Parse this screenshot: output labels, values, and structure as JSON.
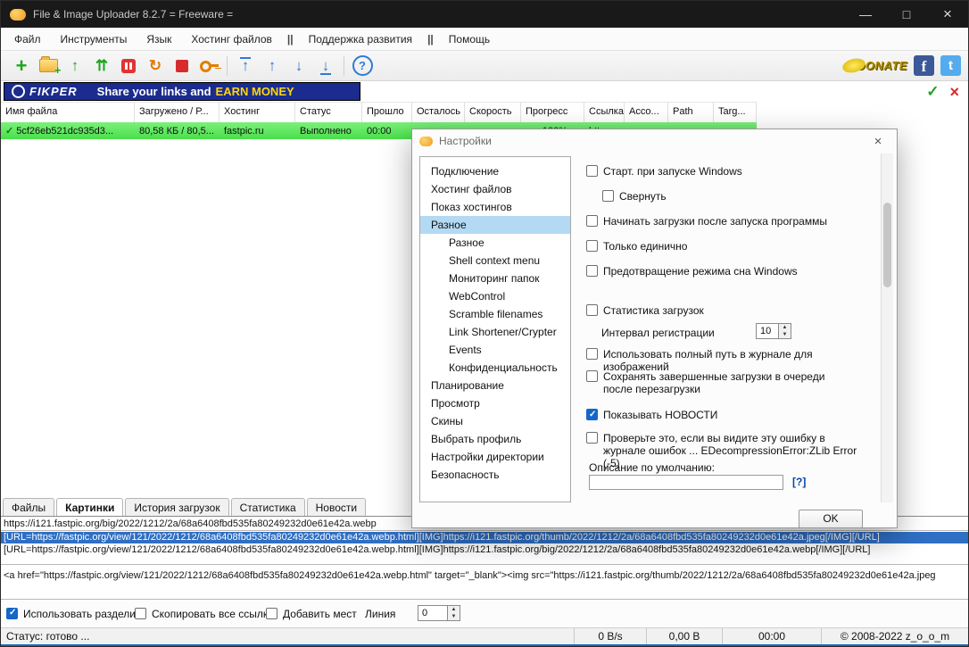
{
  "titlebar": {
    "title": "File & Image Uploader 8.2.7  = Freeware =",
    "minimize": "—",
    "maximize": "□",
    "close": "×"
  },
  "menu": {
    "items": [
      "Файл",
      "Инструменты",
      "Язык",
      "Хостинг файлов",
      "||",
      "Поддержка развития",
      "||",
      "Помощь"
    ]
  },
  "toolbar": {
    "icons": [
      {
        "name": "add",
        "glyph": "+"
      },
      {
        "name": "add-folder",
        "glyph": ""
      },
      {
        "name": "upload",
        "glyph": "↑"
      },
      {
        "name": "upload-all",
        "glyph": "⇈"
      },
      {
        "name": "pause",
        "glyph": ""
      },
      {
        "name": "restart",
        "glyph": "↻"
      },
      {
        "name": "stop",
        "glyph": ""
      },
      {
        "name": "key",
        "glyph": ""
      },
      {
        "name": "move-top",
        "glyph": "↑"
      },
      {
        "name": "move-up",
        "glyph": "↑"
      },
      {
        "name": "move-down",
        "glyph": "↓"
      },
      {
        "name": "move-bottom",
        "glyph": "↓"
      },
      {
        "name": "help",
        "glyph": "?"
      }
    ],
    "donate": "DONATE",
    "social": [
      {
        "name": "facebook-icon",
        "glyph": "f"
      },
      {
        "name": "twitter-icon",
        "glyph": "t"
      }
    ]
  },
  "banner": {
    "brand": "FIKPER",
    "text": "Share your links and",
    "highlight": "EARN MONEY",
    "apply_glyph": "✓",
    "close_glyph": "×"
  },
  "table": {
    "columns": [
      "Имя файла",
      "Загружено / Р...",
      "Хостинг",
      "Статус",
      "Прошло",
      "Осталось",
      "Скорость",
      "Прогресс",
      "Ссылка",
      "Acco...",
      "Path",
      "Targ..."
    ],
    "rows": [
      {
        "icon": "✓",
        "cells": [
          "5cf26eb521dc935d3...",
          "80,58 КБ / 80,5...",
          "fastpic.ru",
          "Выполнено",
          "00:00",
          "",
          "",
          "100%",
          "htt...",
          "",
          "",
          ""
        ]
      }
    ]
  },
  "dialog": {
    "title": "Настройки",
    "close": "×",
    "tree": [
      {
        "label": "Подключение",
        "selected": false
      },
      {
        "label": "Хостинг файлов",
        "selected": false
      },
      {
        "label": "Показ хостингов",
        "selected": false
      },
      {
        "label": "Разное",
        "selected": true
      },
      {
        "label": "Разное",
        "selected": false
      },
      {
        "label": "Shell context menu",
        "selected": false
      },
      {
        "label": "Мониторинг папок",
        "selected": false
      },
      {
        "label": "WebControl",
        "selected": false
      },
      {
        "label": "Scramble filenames",
        "selected": false
      },
      {
        "label": "Link Shortener/Crypter",
        "selected": false
      },
      {
        "label": "Events",
        "selected": false
      },
      {
        "label": "Конфиденциальность",
        "selected": false
      },
      {
        "label": "Планирование",
        "selected": false
      },
      {
        "label": "Просмотр",
        "selected": false
      },
      {
        "label": "Скины",
        "selected": false
      },
      {
        "label": "Выбрать профиль",
        "selected": false
      },
      {
        "label": "Настройки директории",
        "selected": false
      },
      {
        "label": "Безопасность",
        "selected": false
      }
    ],
    "checkboxes": [
      {
        "label": "Старт. при запуске Windows",
        "checked": false
      },
      {
        "label": "Свернуть",
        "checked": false
      },
      {
        "label": "Начинать загрузки после запуска программы",
        "checked": false
      },
      {
        "label": "Только единично",
        "checked": false
      },
      {
        "label": "Предотвращение режима сна Windows",
        "checked": false
      },
      {
        "label": "Статистика загрузок",
        "checked": false
      },
      {
        "label": "Использовать полный путь в журнале для изображений",
        "checked": false
      },
      {
        "label": "Сохранять завершенные загрузки в очереди после перезагрузки",
        "checked": false
      },
      {
        "label": "Показывать НОВОСТИ",
        "checked": true
      },
      {
        "label": "Проверьте это, если вы видите эту ошибку в журнале ошибок ...  EDecompressionError:ZLib Error (-5)",
        "checked": false
      }
    ],
    "interval_label": "Интервал регистрации",
    "interval_value": "10",
    "description_label": "Описание по умолчанию:",
    "description_value": "",
    "help_link": "[?]",
    "ok": "OK"
  },
  "tabs": {
    "items": [
      {
        "label": "Файлы",
        "active": false
      },
      {
        "label": "Картинки",
        "active": true
      },
      {
        "label": "История загрузок",
        "active": false
      },
      {
        "label": "Статистика",
        "active": false
      },
      {
        "label": "Новости",
        "active": false
      }
    ]
  },
  "links": {
    "lines": [
      {
        "text": "https://i121.fastpic.org/big/2022/1212/2a/68a6408fbd535fa80249232d0e61e42a.webp",
        "selected": false
      },
      {
        "text": "[URL=https://fastpic.org/view/121/2022/1212/68a6408fbd535fa80249232d0e61e42a.webp.html][IMG]https://i121.fastpic.org/thumb/2022/1212/2a/68a6408fbd535fa80249232d0e61e42a.jpeg[/IMG][/URL]",
        "selected": true
      },
      {
        "text": "[URL=https://fastpic.org/view/121/2022/1212/68a6408fbd535fa80249232d0e61e42a.webp.html][IMG]https://i121.fastpic.org/big/2022/1212/2a/68a6408fbd535fa80249232d0e61e42a.webp[/IMG][/URL]",
        "selected": false
      },
      {
        "text": "<a href=\"https://fastpic.org/view/121/2022/1212/68a6408fbd535fa80249232d0e61e42a.webp.html\" target=\"_blank\"><img src=\"https://i121.fastpic.org/thumb/2022/1212/2a/68a6408fbd535fa80249232d0e61e42a.jpeg",
        "selected": false
      }
    ]
  },
  "footer": {
    "checkboxes": [
      {
        "label": "Использовать раздели",
        "checked": true
      },
      {
        "label": "Скопировать все ссылки",
        "checked": false
      },
      {
        "label": "Добавить мест",
        "checked": false
      }
    ],
    "line_label": "Линия",
    "line_value": "0"
  },
  "statusbar": {
    "status": "Статус: готово ...",
    "speed": "0 B/s",
    "size": "0,00 B",
    "time": "00:00",
    "copyright": "© 2008-2022 z_o_o_m"
  },
  "colors": {
    "row_green": "#4ade4a",
    "banner_blue": "#1b2b8e",
    "earn_yellow": "#ffd60a",
    "selection_blue": "#2f6fc4",
    "accent_blue": "#1565c0"
  }
}
